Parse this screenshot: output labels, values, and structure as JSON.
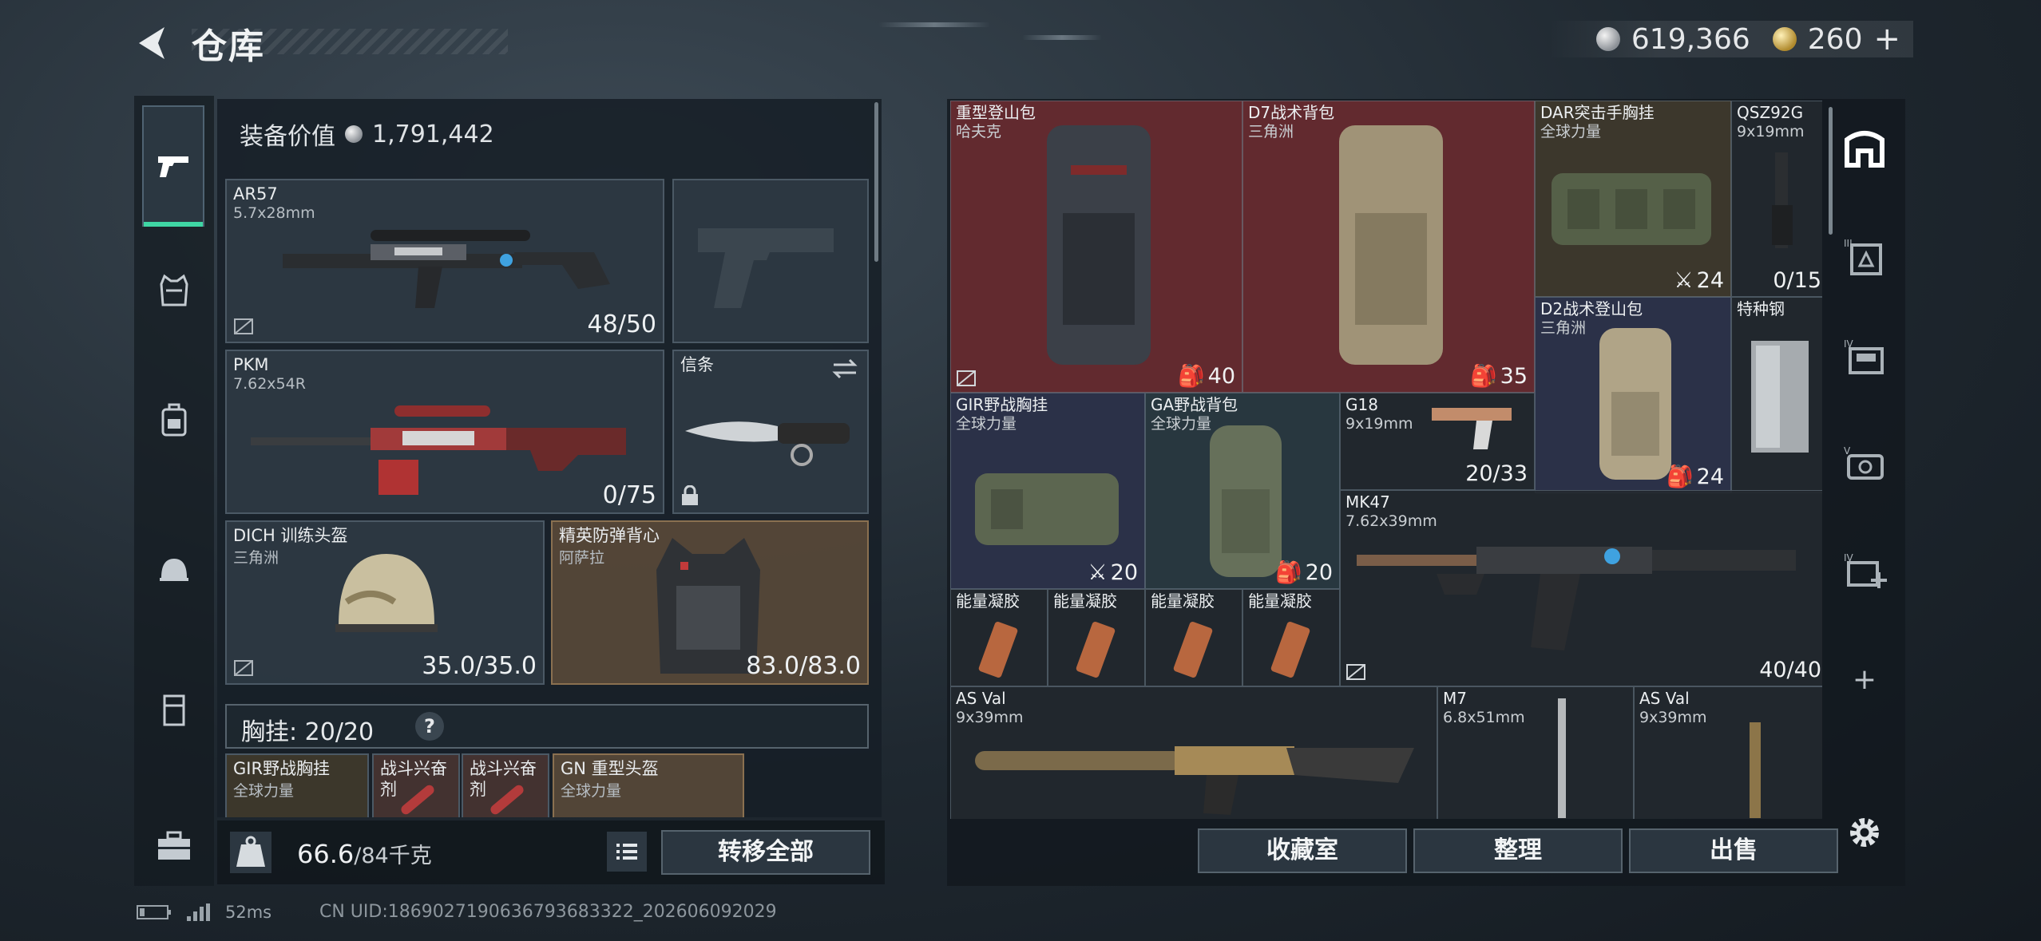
{
  "header": {
    "title": "仓库",
    "silver": "619,366",
    "gold": "260"
  },
  "side_tabs": [
    "pistol-icon",
    "vest-icon",
    "backpack-icon",
    "helmet-icon",
    "armor-icon",
    "toolbox-icon"
  ],
  "left": {
    "equip_label": "装备价值",
    "equip_value": "1,791,442",
    "slots": {
      "primary": {
        "name": "AR57",
        "sub": "5.7x28mm",
        "count": "48/50"
      },
      "secondary": {
        "name": "PKM",
        "sub": "7.62x54R",
        "count": "0/75"
      },
      "melee": {
        "name": "信条"
      },
      "helmet": {
        "name": "DICH 训练头盔",
        "sub": "三角洲",
        "count": "35.0/35.0"
      },
      "armor": {
        "name": "精英防弹背心",
        "sub": "阿萨拉",
        "count": "83.0/83.0"
      }
    },
    "rig": {
      "label": "胸挂:",
      "value": "20/20",
      "help": "?"
    },
    "rig_items": [
      {
        "name": "GIR野战胸挂",
        "sub": "全球力量"
      },
      {
        "name": "战斗兴奋剂"
      },
      {
        "name": "战斗兴奋剂"
      },
      {
        "name": "GN 重型头盔",
        "sub": "全球力量"
      }
    ],
    "weight": "66.6",
    "weight_max": "/84千克",
    "transfer_label": "转移全部"
  },
  "grid": {
    "bag1": {
      "name": "重型登山包",
      "sub": "哈夫克",
      "count": "40"
    },
    "bag2": {
      "name": "D7战术背包",
      "sub": "三角洲",
      "count": "35"
    },
    "dar": {
      "name": "DAR突击手胸挂",
      "sub": "全球力量",
      "count": "24"
    },
    "qsz": {
      "name": "QSZ92G",
      "sub": "9x19mm",
      "count": "0/15"
    },
    "d2": {
      "name": "D2战术登山包",
      "sub": "三角洲",
      "count": "24"
    },
    "steel": {
      "name": "特种钢"
    },
    "gir": {
      "name": "GIR野战胸挂",
      "sub": "全球力量",
      "count": "20"
    },
    "ga": {
      "name": "GA野战背包",
      "sub": "全球力量",
      "count": "20"
    },
    "g18": {
      "name": "G18",
      "sub": "9x19mm",
      "count": "20/33"
    },
    "mk47": {
      "name": "MK47",
      "sub": "7.62x39mm",
      "count": "40/40"
    },
    "gel": [
      "能量凝胶",
      "能量凝胶",
      "能量凝胶",
      "能量凝胶"
    ],
    "asval1": {
      "name": "AS Val",
      "sub": "9x39mm"
    },
    "m7": {
      "name": "M7",
      "sub": "6.8x51mm"
    },
    "asval2": {
      "name": "AS Val",
      "sub": "9x39mm"
    }
  },
  "right_buttons": {
    "collection": "收藏室",
    "sort": "整理",
    "sell": "出售"
  },
  "right_tabs": [
    "stash-icon",
    "III",
    "IV",
    "V",
    "IV+",
    "+",
    "-",
    "settings-icon"
  ],
  "status": {
    "ping": "52ms",
    "uid": "CN UID:1869027190636793683322_202606092029"
  }
}
